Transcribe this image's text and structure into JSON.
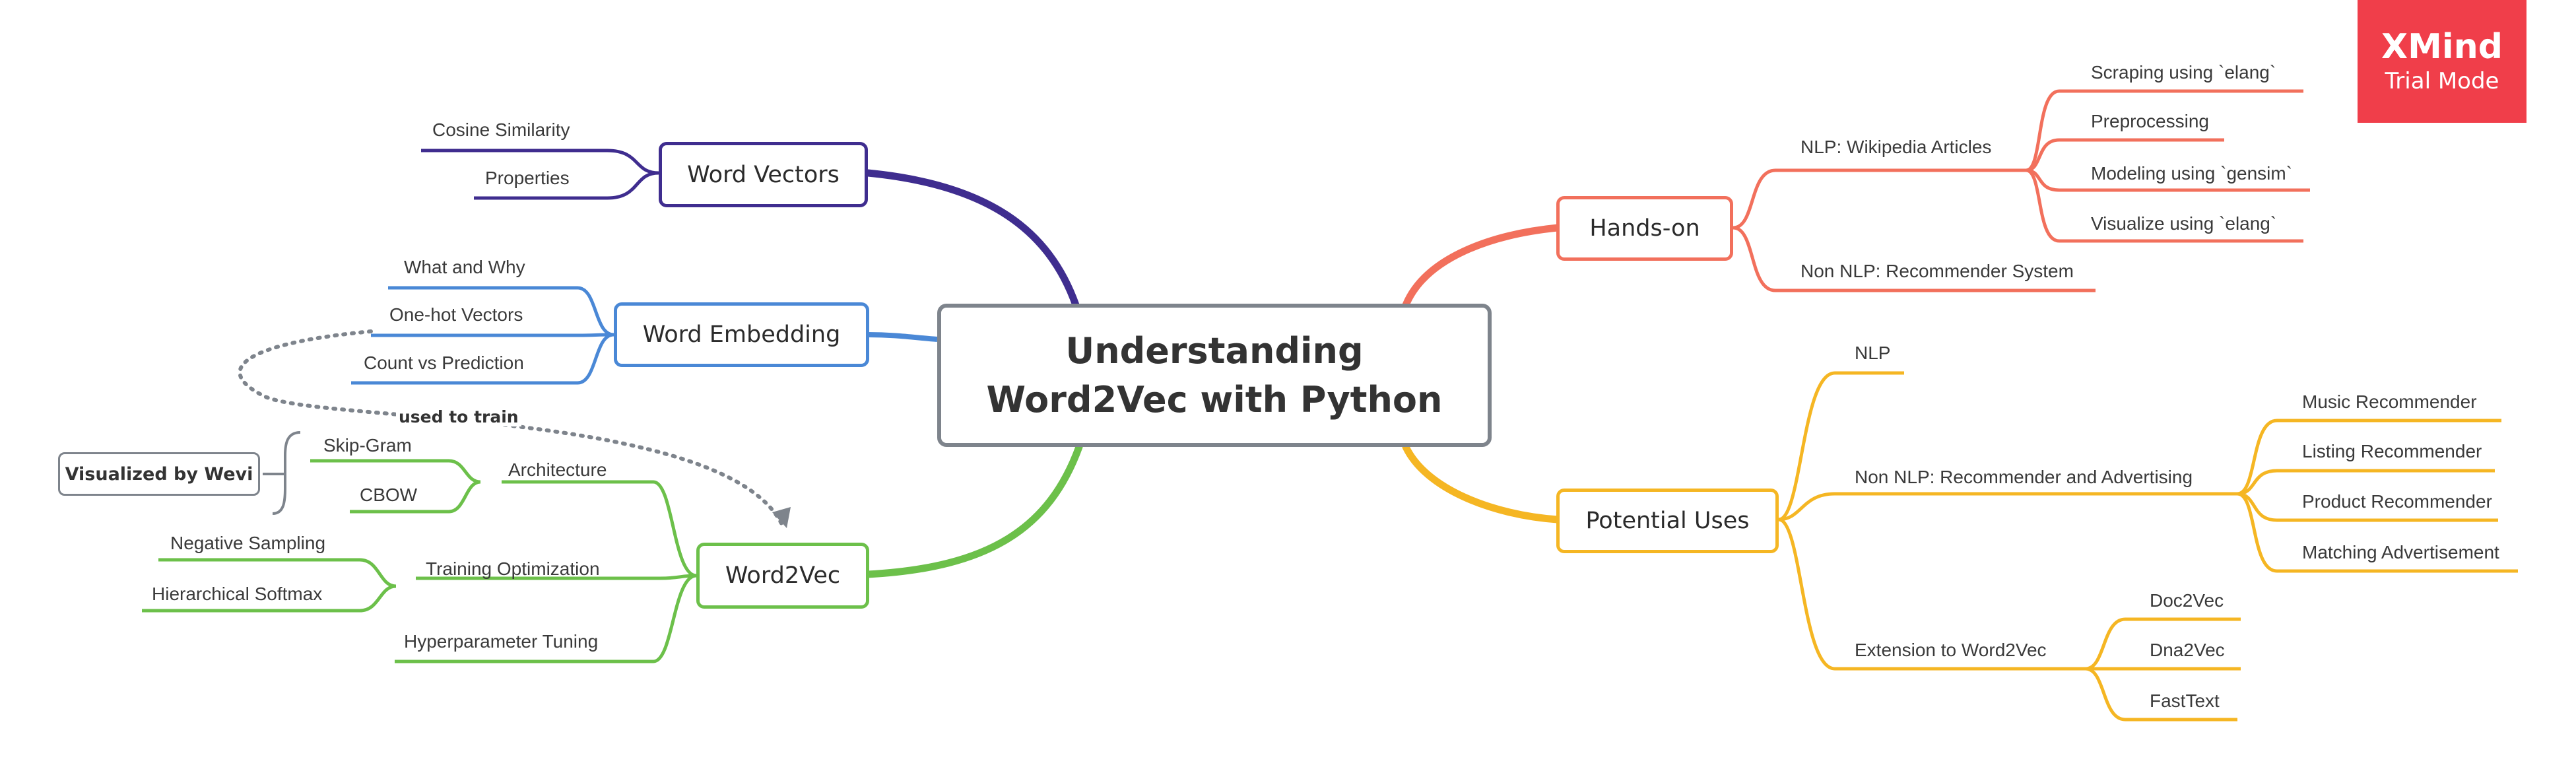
{
  "central_topic": {
    "line1": "Understanding",
    "line2": "Word2Vec with Python"
  },
  "branches": {
    "word_vectors": {
      "label": "Word Vectors",
      "color": "#3f2d8f",
      "children": [
        "Cosine Similarity",
        "Properties"
      ]
    },
    "word_embedding": {
      "label": "Word Embedding",
      "color": "#4a88d6",
      "children": [
        "What and Why",
        "One-hot Vectors",
        "Count vs Prediction"
      ]
    },
    "word2vec": {
      "label": "Word2Vec",
      "color": "#6cc04a",
      "children": {
        "architecture": {
          "label": "Architecture",
          "children": [
            "Skip-Gram",
            "CBOW"
          ]
        },
        "training_optimization": {
          "label": "Training Optimization",
          "children": [
            "Negative Sampling",
            "Hierarchical Softmax"
          ]
        },
        "hyperparameter_tuning": {
          "label": "Hyperparameter Tuning"
        }
      }
    },
    "hands_on": {
      "label": "Hands-on",
      "color": "#f2705c",
      "children": {
        "nlp_wikipedia": {
          "label": "NLP: Wikipedia Articles",
          "children": [
            "Scraping using `elang`",
            "Preprocessing",
            "Modeling using `gensim`",
            "Visualize using `elang`"
          ]
        },
        "non_nlp_recommender": {
          "label": "Non NLP: Recommender System"
        }
      }
    },
    "potential_uses": {
      "label": "Potential Uses",
      "color": "#f5b623",
      "children": {
        "nlp": {
          "label": "NLP"
        },
        "non_nlp_rec_adv": {
          "label": "Non NLP: Recommender and Advertising",
          "children": [
            "Music Recommender",
            "Listing Recommender",
            "Product Recommender",
            "Matching Advertisement"
          ]
        },
        "extension": {
          "label": "Extension to Word2Vec",
          "children": [
            "Doc2Vec",
            "Dna2Vec",
            "FastText"
          ]
        }
      }
    }
  },
  "floating_topic": {
    "label": "Visualized by Wevi"
  },
  "relationship": {
    "label": "used to train",
    "color": "#7e848c"
  },
  "watermark": {
    "title": "XMind",
    "subtitle": "Trial Mode",
    "color": "#f03e4a"
  }
}
